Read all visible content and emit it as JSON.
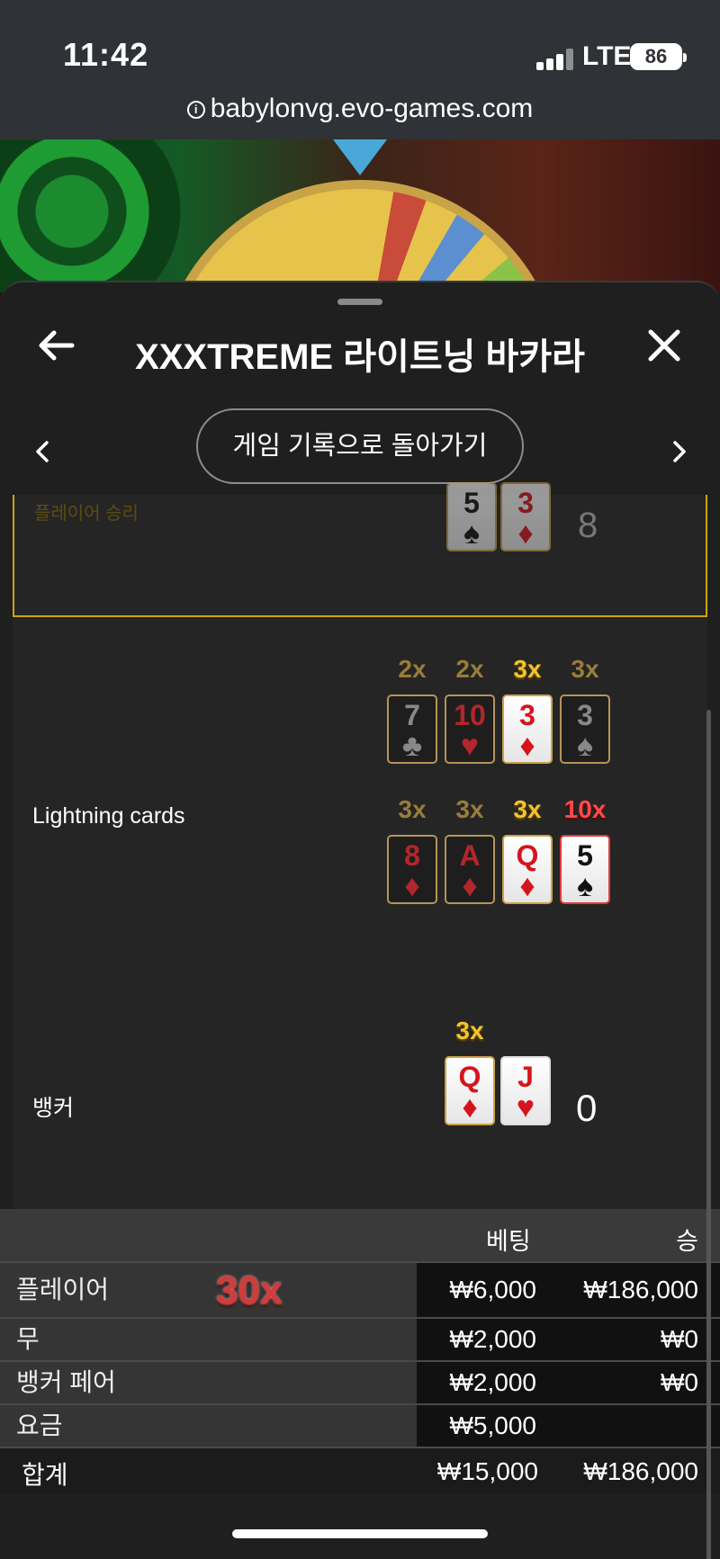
{
  "status": {
    "time": "11:42",
    "network": "LTE",
    "battery": "86"
  },
  "browser": {
    "url": "babylonvg.evo-games.com"
  },
  "sheet": {
    "title": "XXXTREME 라이트닝 바카라",
    "back_to_history": "게임 기록으로 돌아가기"
  },
  "result": {
    "player_label": "플레이어 승리",
    "player_cards": [
      {
        "rank": "5",
        "suit": "♠"
      },
      {
        "rank": "3",
        "suit": "♦"
      }
    ],
    "player_total": "8",
    "lightning_label": "Lightning cards",
    "lightning_cards": [
      {
        "mult": "2x",
        "rank": "7",
        "suit": "♣"
      },
      {
        "mult": "2x",
        "rank": "10",
        "suit": "♥"
      },
      {
        "mult": "3x",
        "rank": "3",
        "suit": "♦"
      },
      {
        "mult": "3x",
        "rank": "3",
        "suit": "♠"
      },
      {
        "mult": "3x",
        "rank": "8",
        "suit": "♦"
      },
      {
        "mult": "3x",
        "rank": "A",
        "suit": "♦"
      },
      {
        "mult": "3x",
        "rank": "Q",
        "suit": "♦"
      },
      {
        "mult": "10x",
        "rank": "5",
        "suit": "♠"
      }
    ],
    "banker_label": "뱅커",
    "banker_mult": "3x",
    "banker_cards": [
      {
        "rank": "Q",
        "suit": "♦"
      },
      {
        "rank": "J",
        "suit": "♥"
      }
    ],
    "banker_total": "0"
  },
  "bets": {
    "col_bet": "베팅",
    "col_win": "승",
    "rows": [
      {
        "name": "플레이어",
        "multiplier": "30x",
        "bet": "₩6,000",
        "win": "₩186,000"
      },
      {
        "name": "무",
        "bet": "₩2,000",
        "win": "₩0"
      },
      {
        "name": "뱅커 페어",
        "bet": "₩2,000",
        "win": "₩0"
      },
      {
        "name": "요금",
        "bet": "₩5,000",
        "win": ""
      }
    ],
    "total_label": "합계",
    "total_bet": "₩15,000",
    "total_win": "₩186,000"
  }
}
